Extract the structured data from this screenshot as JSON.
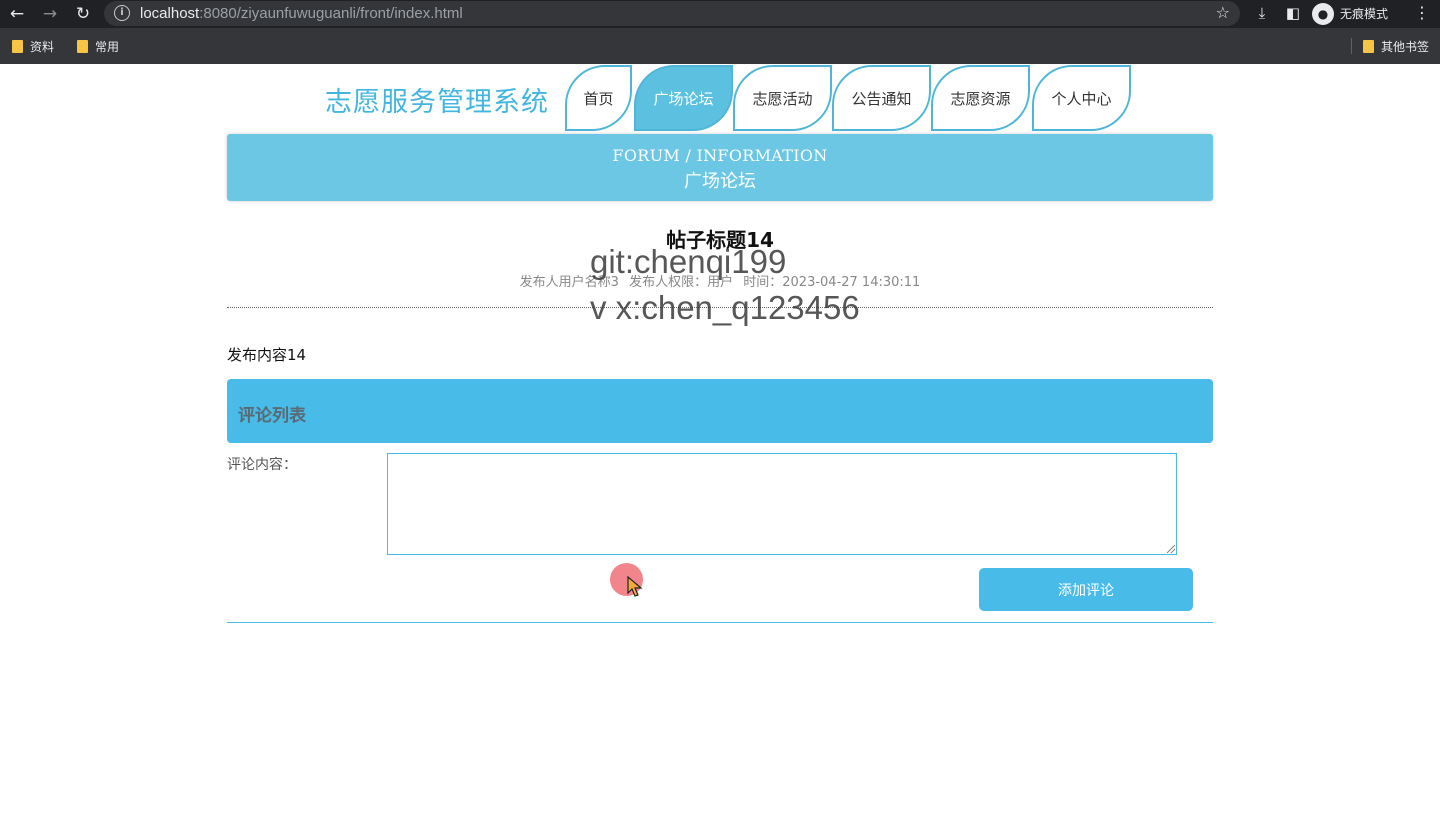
{
  "browser": {
    "url_host": "localhost",
    "url_rest": ":8080/ziyaunfuwuguanli/front/index.html",
    "incognito_label": "无痕模式",
    "bookmarks": [
      "资料",
      "常用"
    ],
    "other_bookmarks": "其他书签"
  },
  "site": {
    "title": "志愿服务管理系统",
    "nav": [
      "首页",
      "广场论坛",
      "志愿活动",
      "公告通知",
      "志愿资源",
      "个人中心"
    ],
    "active_nav": "广场论坛"
  },
  "banner": {
    "en": "FORUM / INFORMATION",
    "cn": "广场论坛"
  },
  "post": {
    "title": "帖子标题14",
    "author": "发布人用户名称3",
    "role": "发布人权限：用户",
    "time": "时间：2023-04-27 14:30:11",
    "content": "发布内容14"
  },
  "watermark": {
    "line1": "git:chenqi199",
    "line2": "v x:chen_q123456"
  },
  "comments": {
    "header": "评论列表",
    "label": "评论内容：",
    "textarea_value": "",
    "submit_label": "添加评论"
  },
  "colors": {
    "accent": "#48bbe8",
    "nav_active": "#5cc0e0",
    "banner": "#6cc7e4",
    "title": "#43b5de"
  }
}
